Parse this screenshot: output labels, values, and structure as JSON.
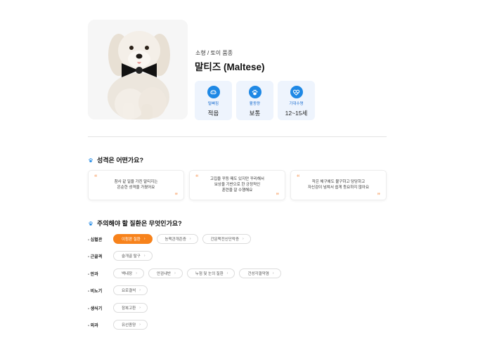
{
  "breed": {
    "size_group": "소형 / 토이 품종",
    "name": "말티즈 (Maltese)"
  },
  "stats": [
    {
      "icon": "shedding-icon",
      "label": "털빠짐",
      "value": "적음"
    },
    {
      "icon": "paw-activity-icon",
      "label": "활동량",
      "value": "보통"
    },
    {
      "icon": "heart-lifespan-icon",
      "label": "기대수명",
      "value": "12~15세"
    }
  ],
  "personality": {
    "title": "성격은 어떤가요?",
    "quotes": [
      {
        "lines": [
          "참사 같 일을 가진 말티지는",
          "온순한 성격을 가졌어요"
        ]
      },
      {
        "lines": [
          "고집을 꾸등 때도 있지만 꾸리해서",
          "보상을 기반으로 한 긍정적인",
          "훈련을 잘 수행해요"
        ]
      },
      {
        "lines": [
          "작은 체구에도 불구하고 당당하고",
          "자신감이 넘쳐서 쉽게 등요하지 않아요"
        ]
      }
    ]
  },
  "diseases": {
    "title": "주의해야 할 질환은 무엇인가요?",
    "arrow": "›",
    "categories": [
      {
        "label": "- 심혈관",
        "items": [
          "이첨판 질환",
          "농맥관개존증",
          "간문맥전신단락증"
        ]
      },
      {
        "label": "- 근골격",
        "items": [
          "슬개골 탈구"
        ]
      },
      {
        "label": "- 안과",
        "items": [
          "백내장",
          "안검내반",
          "누점 및 눈의 질환",
          "건성각결막염"
        ]
      },
      {
        "label": "- 비뇨기",
        "items": [
          "요로결석"
        ]
      },
      {
        "label": "- 생식기",
        "items": [
          "잠복고환"
        ]
      },
      {
        "label": "- 외과",
        "items": [
          "유선종양"
        ]
      }
    ]
  },
  "colors": {
    "accent_orange": "#f7821b",
    "accent_blue": "#1e88e5",
    "card_bg": "#eef4fd"
  }
}
